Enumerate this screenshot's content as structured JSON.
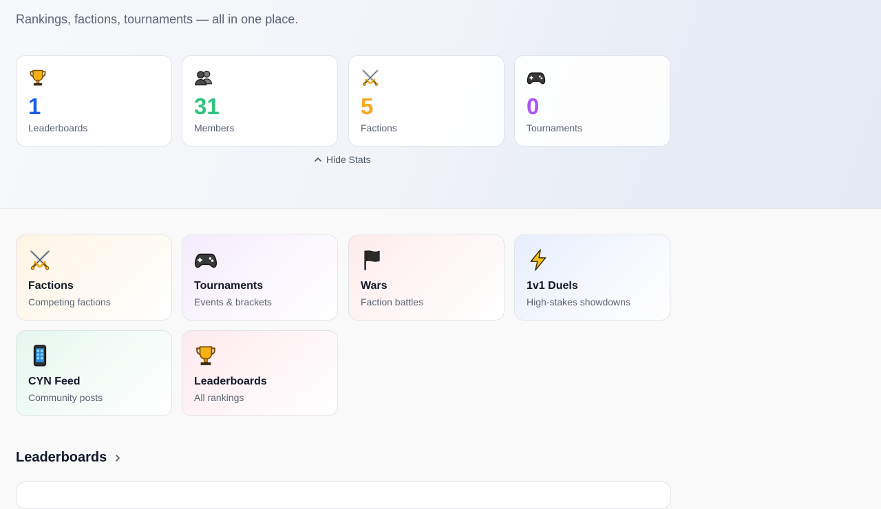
{
  "header": {
    "tagline": "Rankings, factions, tournaments — all in one place."
  },
  "stats": [
    {
      "icon": "trophy-icon",
      "value": "1",
      "label": "Leaderboards",
      "color": "#1d5fe6"
    },
    {
      "icon": "members-icon",
      "value": "31",
      "label": "Members",
      "color": "#2ec27e"
    },
    {
      "icon": "crossed-swords-icon",
      "value": "5",
      "label": "Factions",
      "color": "#f5a623"
    },
    {
      "icon": "gamepad-icon",
      "value": "0",
      "label": "Tournaments",
      "color": "#a855f7"
    }
  ],
  "hide_stats_label": "Hide Stats",
  "nav_cards": [
    {
      "icon": "crossed-swords-icon",
      "title": "Factions",
      "subtitle": "Competing factions",
      "tint": "#fdf4e3"
    },
    {
      "icon": "gamepad-icon",
      "title": "Tournaments",
      "subtitle": "Events & brackets",
      "tint": "#f5ecfc"
    },
    {
      "icon": "flag-icon",
      "title": "Wars",
      "subtitle": "Faction battles",
      "tint": "#fdecec"
    },
    {
      "icon": "lightning-icon",
      "title": "1v1 Duels",
      "subtitle": "High-stakes showdowns",
      "tint": "#e8eefc"
    },
    {
      "icon": "phone-icon",
      "title": "CYN Feed",
      "subtitle": "Community posts",
      "tint": "#e6f7ef"
    },
    {
      "icon": "trophy-icon",
      "title": "Leaderboards",
      "subtitle": "All rankings",
      "tint": "#fdeaee"
    }
  ],
  "section": {
    "title": "Leaderboards"
  }
}
